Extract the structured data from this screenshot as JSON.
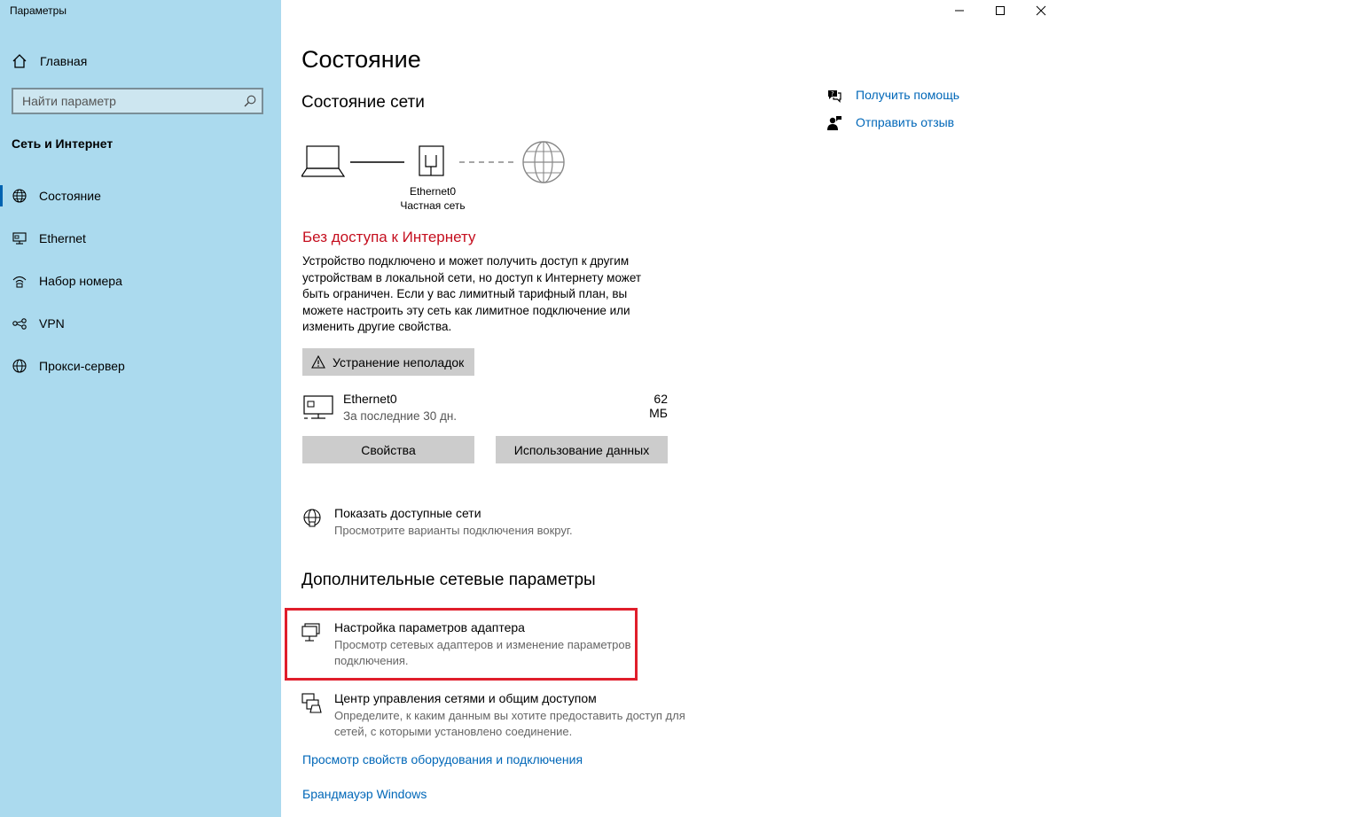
{
  "window": {
    "title": "Параметры",
    "controls": [
      "minimize-icon",
      "maximize-icon",
      "close-icon"
    ]
  },
  "sidebar": {
    "home_label": "Главная",
    "search_placeholder": "Найти параметр",
    "section_title": "Сеть и Интернет",
    "items": [
      {
        "label": "Состояние",
        "icon": "globe-status-icon",
        "active": true
      },
      {
        "label": "Ethernet",
        "icon": "ethernet-icon",
        "active": false
      },
      {
        "label": "Набор номера",
        "icon": "dialup-icon",
        "active": false
      },
      {
        "label": "VPN",
        "icon": "vpn-icon",
        "active": false
      },
      {
        "label": "Прокси-сервер",
        "icon": "proxy-globe-icon",
        "active": false
      }
    ],
    "background_color": "#abdaee",
    "accent_color": "#0063b1"
  },
  "main": {
    "page_title": "Состояние",
    "network_status_title": "Состояние сети",
    "adapter_name": "Ethernet0",
    "adapter_network": "Частная сеть",
    "status_heading": "Без доступа к Интернету",
    "status_color": "#c50f1f",
    "status_description": "Устройство подключено и может получить доступ к другим устройствам в локальной сети, но доступ к Интернету может быть ограничен. Если у вас лимитный тарифный план, вы можете настроить эту сеть как лимитное подключение или изменить другие свойства.",
    "troubleshoot_label": "Устранение неполадок",
    "usage": {
      "name": "Ethernet0",
      "period": "За последние 30 дн.",
      "size": "62 МБ"
    },
    "properties_label": "Свойства",
    "data_usage_label": "Использование данных",
    "show_networks": {
      "title": "Показать доступные сети",
      "desc": "Просмотрите варианты подключения вокруг."
    },
    "advanced_title": "Дополнительные сетевые параметры",
    "adapter_settings": {
      "title": "Настройка параметров адаптера",
      "desc": "Просмотр сетевых адаптеров и изменение параметров подключения."
    },
    "network_center": {
      "title": "Центр управления сетями и общим доступом",
      "desc": "Определите, к каким данным вы хотите предоставить доступ для сетей, с которыми установлено соединение."
    },
    "hardware_link": "Просмотр свойств оборудования и подключения",
    "firewall_link": "Брандмауэр Windows",
    "link_color": "#0067b8",
    "highlight_color": "#e01e2b"
  },
  "help": {
    "get_help": "Получить помощь",
    "feedback": "Отправить отзыв"
  }
}
